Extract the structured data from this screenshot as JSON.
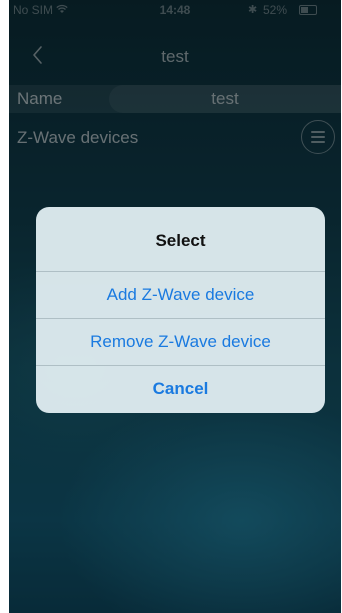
{
  "status_bar": {
    "carrier": "No SIM",
    "time": "14:48",
    "battery_percent": "52%",
    "battery_level": 0.52,
    "icons": [
      "wifi-icon",
      "bluetooth-icon",
      "battery-icon"
    ]
  },
  "nav": {
    "title": "test",
    "back_icon": "chevron-left-icon"
  },
  "form": {
    "name_label": "Name",
    "name_value": "test",
    "devices_label": "Z-Wave devices",
    "menu_icon": "hamburger-menu-icon"
  },
  "alert": {
    "title": "Select",
    "options": [
      {
        "label": "Add Z-Wave device"
      },
      {
        "label": "Remove Z-Wave device"
      }
    ],
    "cancel_label": "Cancel"
  },
  "colors": {
    "accent": "#1a7ae0",
    "background_top": "#0b2a34",
    "background_bottom": "#11526a",
    "alert_background": "#e2eef2"
  }
}
